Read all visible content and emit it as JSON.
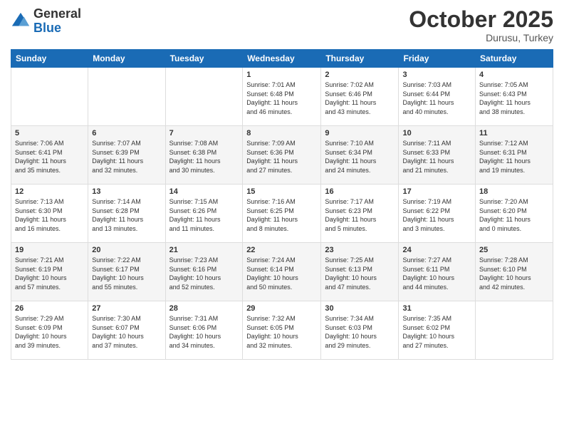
{
  "logo": {
    "general": "General",
    "blue": "Blue"
  },
  "header": {
    "month": "October 2025",
    "location": "Durusu, Turkey"
  },
  "weekdays": [
    "Sunday",
    "Monday",
    "Tuesday",
    "Wednesday",
    "Thursday",
    "Friday",
    "Saturday"
  ],
  "weeks": [
    [
      {
        "day": "",
        "info": ""
      },
      {
        "day": "",
        "info": ""
      },
      {
        "day": "",
        "info": ""
      },
      {
        "day": "1",
        "info": "Sunrise: 7:01 AM\nSunset: 6:48 PM\nDaylight: 11 hours\nand 46 minutes."
      },
      {
        "day": "2",
        "info": "Sunrise: 7:02 AM\nSunset: 6:46 PM\nDaylight: 11 hours\nand 43 minutes."
      },
      {
        "day": "3",
        "info": "Sunrise: 7:03 AM\nSunset: 6:44 PM\nDaylight: 11 hours\nand 40 minutes."
      },
      {
        "day": "4",
        "info": "Sunrise: 7:05 AM\nSunset: 6:43 PM\nDaylight: 11 hours\nand 38 minutes."
      }
    ],
    [
      {
        "day": "5",
        "info": "Sunrise: 7:06 AM\nSunset: 6:41 PM\nDaylight: 11 hours\nand 35 minutes."
      },
      {
        "day": "6",
        "info": "Sunrise: 7:07 AM\nSunset: 6:39 PM\nDaylight: 11 hours\nand 32 minutes."
      },
      {
        "day": "7",
        "info": "Sunrise: 7:08 AM\nSunset: 6:38 PM\nDaylight: 11 hours\nand 30 minutes."
      },
      {
        "day": "8",
        "info": "Sunrise: 7:09 AM\nSunset: 6:36 PM\nDaylight: 11 hours\nand 27 minutes."
      },
      {
        "day": "9",
        "info": "Sunrise: 7:10 AM\nSunset: 6:34 PM\nDaylight: 11 hours\nand 24 minutes."
      },
      {
        "day": "10",
        "info": "Sunrise: 7:11 AM\nSunset: 6:33 PM\nDaylight: 11 hours\nand 21 minutes."
      },
      {
        "day": "11",
        "info": "Sunrise: 7:12 AM\nSunset: 6:31 PM\nDaylight: 11 hours\nand 19 minutes."
      }
    ],
    [
      {
        "day": "12",
        "info": "Sunrise: 7:13 AM\nSunset: 6:30 PM\nDaylight: 11 hours\nand 16 minutes."
      },
      {
        "day": "13",
        "info": "Sunrise: 7:14 AM\nSunset: 6:28 PM\nDaylight: 11 hours\nand 13 minutes."
      },
      {
        "day": "14",
        "info": "Sunrise: 7:15 AM\nSunset: 6:26 PM\nDaylight: 11 hours\nand 11 minutes."
      },
      {
        "day": "15",
        "info": "Sunrise: 7:16 AM\nSunset: 6:25 PM\nDaylight: 11 hours\nand 8 minutes."
      },
      {
        "day": "16",
        "info": "Sunrise: 7:17 AM\nSunset: 6:23 PM\nDaylight: 11 hours\nand 5 minutes."
      },
      {
        "day": "17",
        "info": "Sunrise: 7:19 AM\nSunset: 6:22 PM\nDaylight: 11 hours\nand 3 minutes."
      },
      {
        "day": "18",
        "info": "Sunrise: 7:20 AM\nSunset: 6:20 PM\nDaylight: 11 hours\nand 0 minutes."
      }
    ],
    [
      {
        "day": "19",
        "info": "Sunrise: 7:21 AM\nSunset: 6:19 PM\nDaylight: 10 hours\nand 57 minutes."
      },
      {
        "day": "20",
        "info": "Sunrise: 7:22 AM\nSunset: 6:17 PM\nDaylight: 10 hours\nand 55 minutes."
      },
      {
        "day": "21",
        "info": "Sunrise: 7:23 AM\nSunset: 6:16 PM\nDaylight: 10 hours\nand 52 minutes."
      },
      {
        "day": "22",
        "info": "Sunrise: 7:24 AM\nSunset: 6:14 PM\nDaylight: 10 hours\nand 50 minutes."
      },
      {
        "day": "23",
        "info": "Sunrise: 7:25 AM\nSunset: 6:13 PM\nDaylight: 10 hours\nand 47 minutes."
      },
      {
        "day": "24",
        "info": "Sunrise: 7:27 AM\nSunset: 6:11 PM\nDaylight: 10 hours\nand 44 minutes."
      },
      {
        "day": "25",
        "info": "Sunrise: 7:28 AM\nSunset: 6:10 PM\nDaylight: 10 hours\nand 42 minutes."
      }
    ],
    [
      {
        "day": "26",
        "info": "Sunrise: 7:29 AM\nSunset: 6:09 PM\nDaylight: 10 hours\nand 39 minutes."
      },
      {
        "day": "27",
        "info": "Sunrise: 7:30 AM\nSunset: 6:07 PM\nDaylight: 10 hours\nand 37 minutes."
      },
      {
        "day": "28",
        "info": "Sunrise: 7:31 AM\nSunset: 6:06 PM\nDaylight: 10 hours\nand 34 minutes."
      },
      {
        "day": "29",
        "info": "Sunrise: 7:32 AM\nSunset: 6:05 PM\nDaylight: 10 hours\nand 32 minutes."
      },
      {
        "day": "30",
        "info": "Sunrise: 7:34 AM\nSunset: 6:03 PM\nDaylight: 10 hours\nand 29 minutes."
      },
      {
        "day": "31",
        "info": "Sunrise: 7:35 AM\nSunset: 6:02 PM\nDaylight: 10 hours\nand 27 minutes."
      },
      {
        "day": "",
        "info": ""
      }
    ]
  ]
}
